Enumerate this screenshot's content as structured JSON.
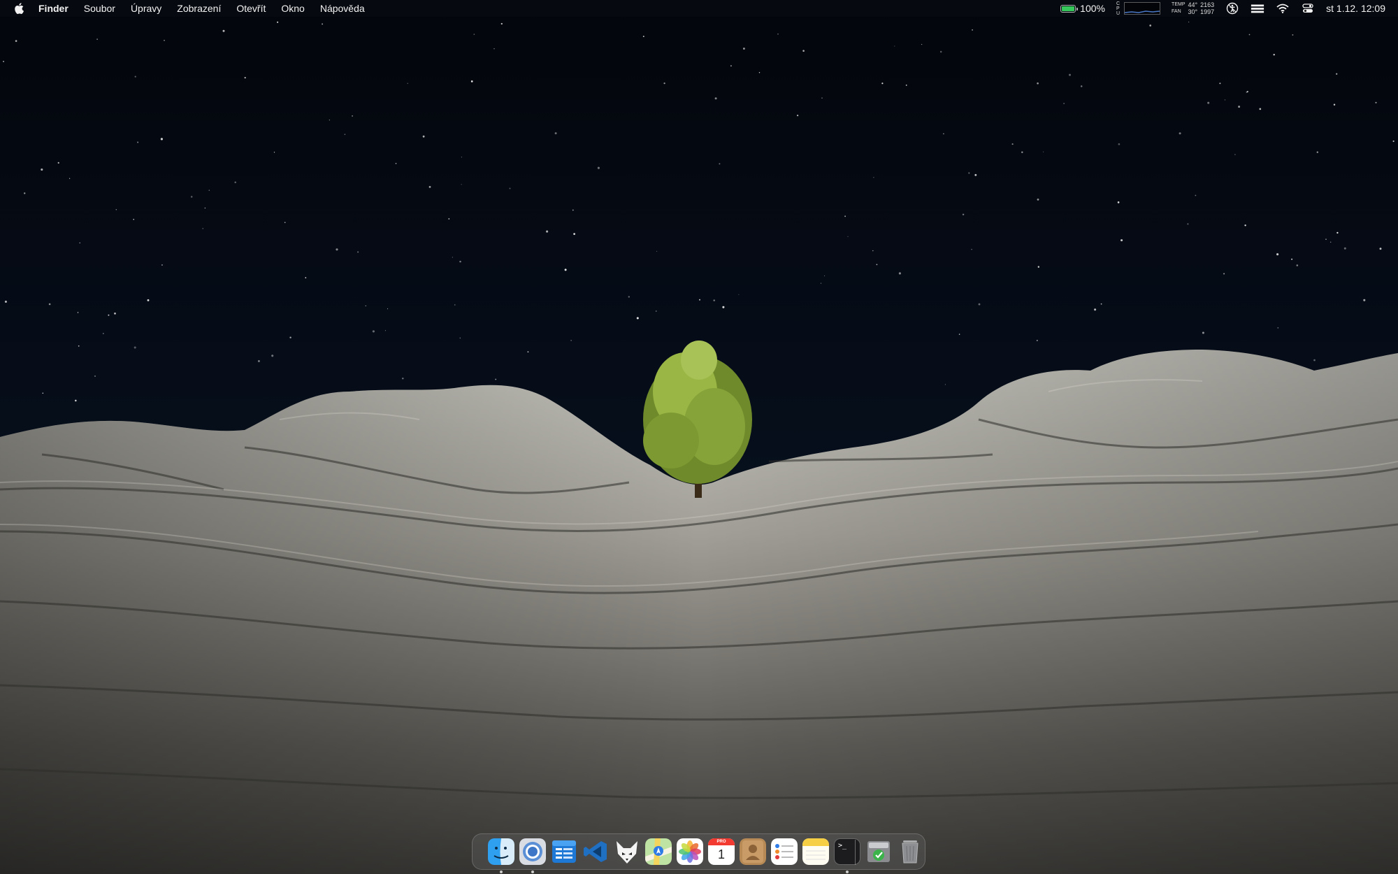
{
  "menubar": {
    "app_name": "Finder",
    "menus": [
      "Soubor",
      "Úpravy",
      "Zobrazení",
      "Otevřít",
      "Okno",
      "Nápověda"
    ],
    "battery_percent": "100%",
    "cpu_letters": [
      "C",
      "P",
      "U"
    ],
    "sensor_labels": [
      "TEMP",
      "FAN"
    ],
    "sensor_values": {
      "temp1": "44°",
      "temp2": "30°",
      "fan1": "2163",
      "fan2": "1997"
    },
    "clock": "st 1.12.  12:09"
  },
  "dock": {
    "calendar_month": "PRO",
    "calendar_day": "1",
    "terminal_prompt": ">_",
    "items": [
      "Finder",
      "Chrome",
      "Files",
      "Visual Studio",
      "Firefox",
      "Maps",
      "Photos",
      "Calendar",
      "Contacts",
      "Reminders",
      "Notes",
      "Terminal",
      "Disk Utility",
      "Trash"
    ]
  },
  "colors": {
    "sky": "#05080f",
    "rock": "#9a9890",
    "tree": "#8ea63a",
    "battery": "#35c759"
  }
}
